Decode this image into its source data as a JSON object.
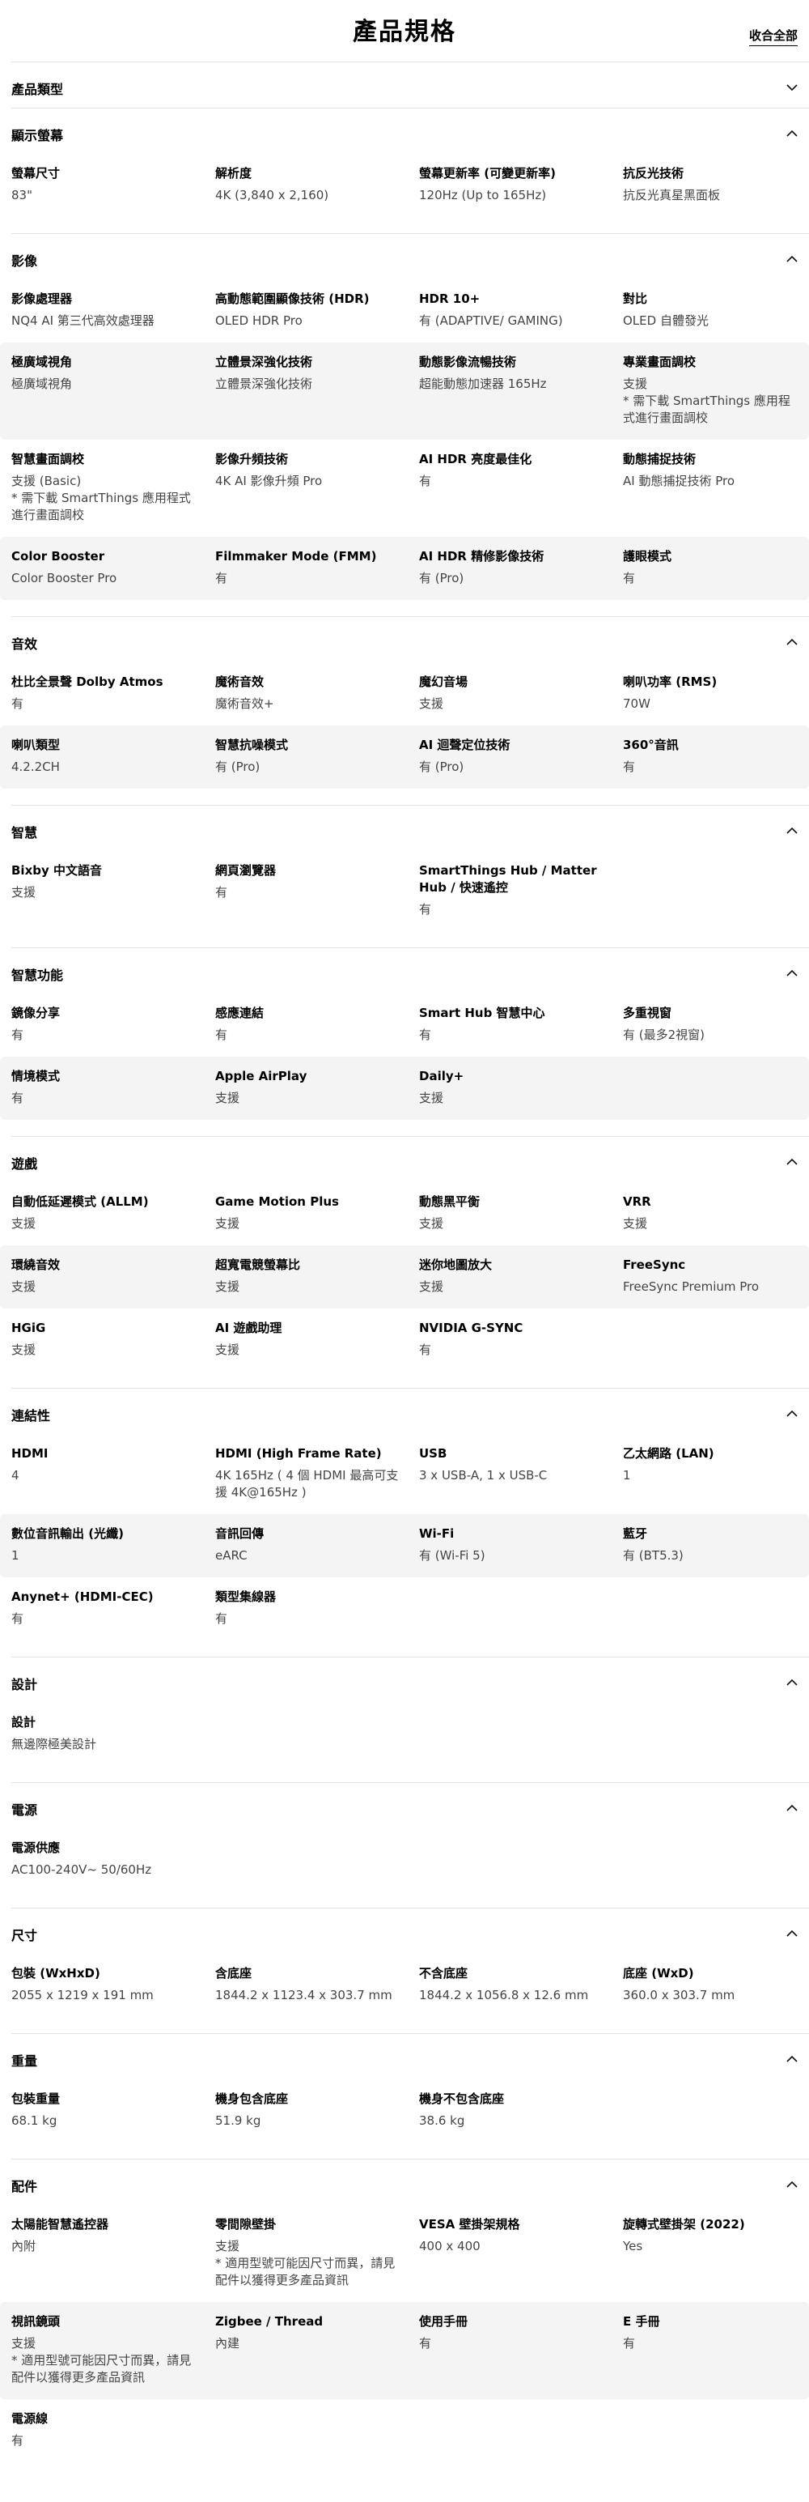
{
  "header": {
    "title": "產品規格",
    "collapse_all": "收合全部"
  },
  "sections": [
    {
      "title": "產品類型",
      "expanded": false,
      "rows": []
    },
    {
      "title": "顯示螢幕",
      "expanded": true,
      "rows": [
        [
          {
            "label": "螢幕尺寸",
            "value": "83\""
          },
          {
            "label": "解析度",
            "value": "4K (3,840 x 2,160)"
          },
          {
            "label": "螢幕更新率 (可變更新率)",
            "value": "120Hz (Up to 165Hz)"
          },
          {
            "label": "抗反光技術",
            "value": "抗反光真星黑面板"
          }
        ]
      ]
    },
    {
      "title": "影像",
      "expanded": true,
      "rows": [
        [
          {
            "label": "影像處理器",
            "value": "NQ4 AI 第三代高效處理器"
          },
          {
            "label": "高動態範圍顯像技術 (HDR)",
            "value": "OLED HDR Pro"
          },
          {
            "label": "HDR 10+",
            "value": "有 (ADAPTIVE/ GAMING)"
          },
          {
            "label": "對比",
            "value": "OLED 自體發光"
          }
        ],
        [
          {
            "label": "極廣域視角",
            "value": "極廣域視角"
          },
          {
            "label": "立體景深強化技術",
            "value": "立體景深強化技術"
          },
          {
            "label": "動態影像流暢技術",
            "value": "超能動態加速器 165Hz"
          },
          {
            "label": "專業畫面調校",
            "value": "支援\n* 需下載 SmartThings 應用程式進行畫面調校"
          }
        ],
        [
          {
            "label": "智慧畫面調校",
            "value": "支援 (Basic)\n* 需下載 SmartThings 應用程式進行畫面調校"
          },
          {
            "label": "影像升頻技術",
            "value": "4K AI 影像升頻 Pro"
          },
          {
            "label": "AI HDR 亮度最佳化",
            "value": "有"
          },
          {
            "label": "動態捕捉技術",
            "value": "AI 動態捕捉技術 Pro"
          }
        ],
        [
          {
            "label": "Color Booster",
            "value": "Color Booster Pro"
          },
          {
            "label": "Filmmaker Mode (FMM)",
            "value": "有"
          },
          {
            "label": "AI HDR 精修影像技術",
            "value": "有 (Pro)"
          },
          {
            "label": "護眼模式",
            "value": "有"
          }
        ]
      ]
    },
    {
      "title": "音效",
      "expanded": true,
      "rows": [
        [
          {
            "label": "杜比全景聲 Dolby Atmos",
            "value": "有"
          },
          {
            "label": "魔術音效",
            "value": "魔術音效+"
          },
          {
            "label": "魔幻音場",
            "value": "支援"
          },
          {
            "label": "喇叭功率 (RMS)",
            "value": "70W"
          }
        ],
        [
          {
            "label": "喇叭類型",
            "value": "4.2.2CH"
          },
          {
            "label": "智慧抗噪模式",
            "value": "有 (Pro)"
          },
          {
            "label": "AI 迴聲定位技術",
            "value": "有 (Pro)"
          },
          {
            "label": "360°音訊",
            "value": "有"
          }
        ]
      ]
    },
    {
      "title": "智慧",
      "expanded": true,
      "rows": [
        [
          {
            "label": "Bixby 中文語音",
            "value": "支援"
          },
          {
            "label": "網頁瀏覽器",
            "value": "有"
          },
          {
            "label": "SmartThings Hub / Matter Hub / 快速遙控",
            "value": "有"
          },
          {
            "label": "",
            "value": ""
          }
        ]
      ]
    },
    {
      "title": "智慧功能",
      "expanded": true,
      "rows": [
        [
          {
            "label": "鏡像分享",
            "value": "有"
          },
          {
            "label": "感應連結",
            "value": "有"
          },
          {
            "label": "Smart Hub 智慧中心",
            "value": "有"
          },
          {
            "label": "多重視窗",
            "value": "有 (最多2視窗)"
          }
        ],
        [
          {
            "label": "情境模式",
            "value": "有"
          },
          {
            "label": "Apple AirPlay",
            "value": "支援"
          },
          {
            "label": "Daily+",
            "value": "支援"
          },
          {
            "label": "",
            "value": ""
          }
        ]
      ]
    },
    {
      "title": "遊戲",
      "expanded": true,
      "rows": [
        [
          {
            "label": "自動低延遲模式 (ALLM)",
            "value": "支援"
          },
          {
            "label": "Game Motion Plus",
            "value": "支援"
          },
          {
            "label": "動態黑平衡",
            "value": "支援"
          },
          {
            "label": "VRR",
            "value": "支援"
          }
        ],
        [
          {
            "label": "環繞音效",
            "value": "支援"
          },
          {
            "label": "超寬電競螢幕比",
            "value": "支援"
          },
          {
            "label": "迷你地圖放大",
            "value": "支援"
          },
          {
            "label": "FreeSync",
            "value": "FreeSync Premium Pro"
          }
        ],
        [
          {
            "label": "HGiG",
            "value": "支援"
          },
          {
            "label": "AI 遊戲助理",
            "value": "支援"
          },
          {
            "label": "NVIDIA G-SYNC",
            "value": "有"
          },
          {
            "label": "",
            "value": ""
          }
        ]
      ]
    },
    {
      "title": "連結性",
      "expanded": true,
      "rows": [
        [
          {
            "label": "HDMI",
            "value": "4"
          },
          {
            "label": "HDMI (High Frame Rate)",
            "value": "4K 165Hz ( 4 個 HDMI 最高可支援 4K@165Hz )"
          },
          {
            "label": "USB",
            "value": "3 x USB-A, 1 x USB-C"
          },
          {
            "label": "乙太網路 (LAN)",
            "value": "1"
          }
        ],
        [
          {
            "label": "數位音訊輸出 (光纖)",
            "value": "1"
          },
          {
            "label": "音訊回傳",
            "value": "eARC"
          },
          {
            "label": "Wi-Fi",
            "value": "有 (Wi-Fi 5)"
          },
          {
            "label": "藍牙",
            "value": "有 (BT5.3)"
          }
        ],
        [
          {
            "label": "Anynet+ (HDMI-CEC)",
            "value": "有"
          },
          {
            "label": "類型集線器",
            "value": "有"
          },
          {
            "label": "",
            "value": ""
          },
          {
            "label": "",
            "value": ""
          }
        ]
      ]
    },
    {
      "title": "設計",
      "expanded": true,
      "rows": [
        [
          {
            "label": "設計",
            "value": "無邊際極美設計"
          },
          {
            "label": "",
            "value": ""
          },
          {
            "label": "",
            "value": ""
          },
          {
            "label": "",
            "value": ""
          }
        ]
      ]
    },
    {
      "title": "電源",
      "expanded": true,
      "rows": [
        [
          {
            "label": "電源供應",
            "value": "AC100-240V~ 50/60Hz"
          },
          {
            "label": "",
            "value": ""
          },
          {
            "label": "",
            "value": ""
          },
          {
            "label": "",
            "value": ""
          }
        ]
      ]
    },
    {
      "title": "尺寸",
      "expanded": true,
      "rows": [
        [
          {
            "label": "包裝 (WxHxD)",
            "value": "2055 x 1219 x 191 mm"
          },
          {
            "label": "含底座",
            "value": "1844.2 x 1123.4 x 303.7 mm"
          },
          {
            "label": "不含底座",
            "value": "1844.2 x 1056.8 x 12.6 mm"
          },
          {
            "label": "底座 (WxD)",
            "value": "360.0 x 303.7 mm"
          }
        ]
      ]
    },
    {
      "title": "重量",
      "expanded": true,
      "rows": [
        [
          {
            "label": "包裝重量",
            "value": "68.1 kg"
          },
          {
            "label": "機身包含底座",
            "value": "51.9 kg"
          },
          {
            "label": "機身不包含底座",
            "value": "38.6 kg"
          },
          {
            "label": "",
            "value": ""
          }
        ]
      ]
    },
    {
      "title": "配件",
      "expanded": true,
      "rows": [
        [
          {
            "label": "太陽能智慧遙控器",
            "value": "內附"
          },
          {
            "label": "零間隙壁掛",
            "value": "支援\n* 適用型號可能因尺寸而異，請見配件以獲得更多產品資訊"
          },
          {
            "label": "VESA 壁掛架規格",
            "value": "400 x 400"
          },
          {
            "label": "旋轉式壁掛架 (2022)",
            "value": "Yes"
          }
        ],
        [
          {
            "label": "視訊鏡頭",
            "value": "支援\n* 適用型號可能因尺寸而異，請見配件以獲得更多產品資訊"
          },
          {
            "label": "Zigbee / Thread",
            "value": "內建"
          },
          {
            "label": "使用手冊",
            "value": "有"
          },
          {
            "label": "E 手冊",
            "value": "有"
          }
        ],
        [
          {
            "label": "電源線",
            "value": "有"
          },
          {
            "label": "",
            "value": ""
          },
          {
            "label": "",
            "value": ""
          },
          {
            "label": "",
            "value": ""
          }
        ]
      ]
    }
  ]
}
